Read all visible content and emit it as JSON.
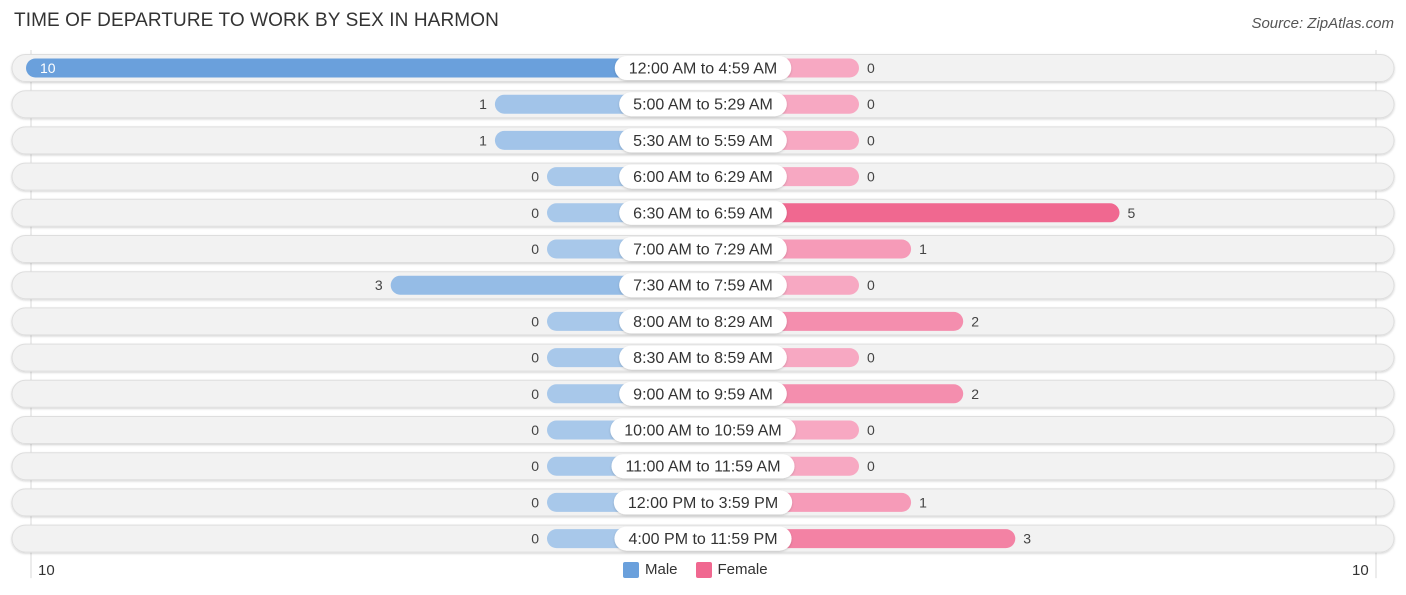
{
  "title": "TIME OF DEPARTURE TO WORK BY SEX IN HARMON",
  "source": "Source: ZipAtlas.com",
  "legend": {
    "male_label": "Male",
    "female_label": "Female"
  },
  "axis": {
    "left_label": "10",
    "right_label": "10"
  },
  "colors": {
    "male": "#6aa0dc",
    "male_light": "#a8c8ea",
    "female": "#f06890",
    "female_light": "#f7a8c2",
    "track": "#f2f2f2"
  },
  "chart_data": {
    "type": "bar",
    "orientation": "horizontal-diverging",
    "title": "TIME OF DEPARTURE TO WORK BY SEX IN HARMON",
    "xlabel": "",
    "ylabel": "",
    "xlim": [
      -10,
      10
    ],
    "legend_position": "bottom-center",
    "categories": [
      "12:00 AM to 4:59 AM",
      "5:00 AM to 5:29 AM",
      "5:30 AM to 5:59 AM",
      "6:00 AM to 6:29 AM",
      "6:30 AM to 6:59 AM",
      "7:00 AM to 7:29 AM",
      "7:30 AM to 7:59 AM",
      "8:00 AM to 8:29 AM",
      "8:30 AM to 8:59 AM",
      "9:00 AM to 9:59 AM",
      "10:00 AM to 10:59 AM",
      "11:00 AM to 11:59 AM",
      "12:00 PM to 3:59 PM",
      "4:00 PM to 11:59 PM"
    ],
    "series": [
      {
        "name": "Male",
        "values": [
          10,
          1,
          1,
          0,
          0,
          0,
          3,
          0,
          0,
          0,
          0,
          0,
          0,
          0
        ]
      },
      {
        "name": "Female",
        "values": [
          0,
          0,
          0,
          0,
          5,
          1,
          0,
          2,
          0,
          2,
          0,
          0,
          1,
          3
        ]
      }
    ]
  }
}
